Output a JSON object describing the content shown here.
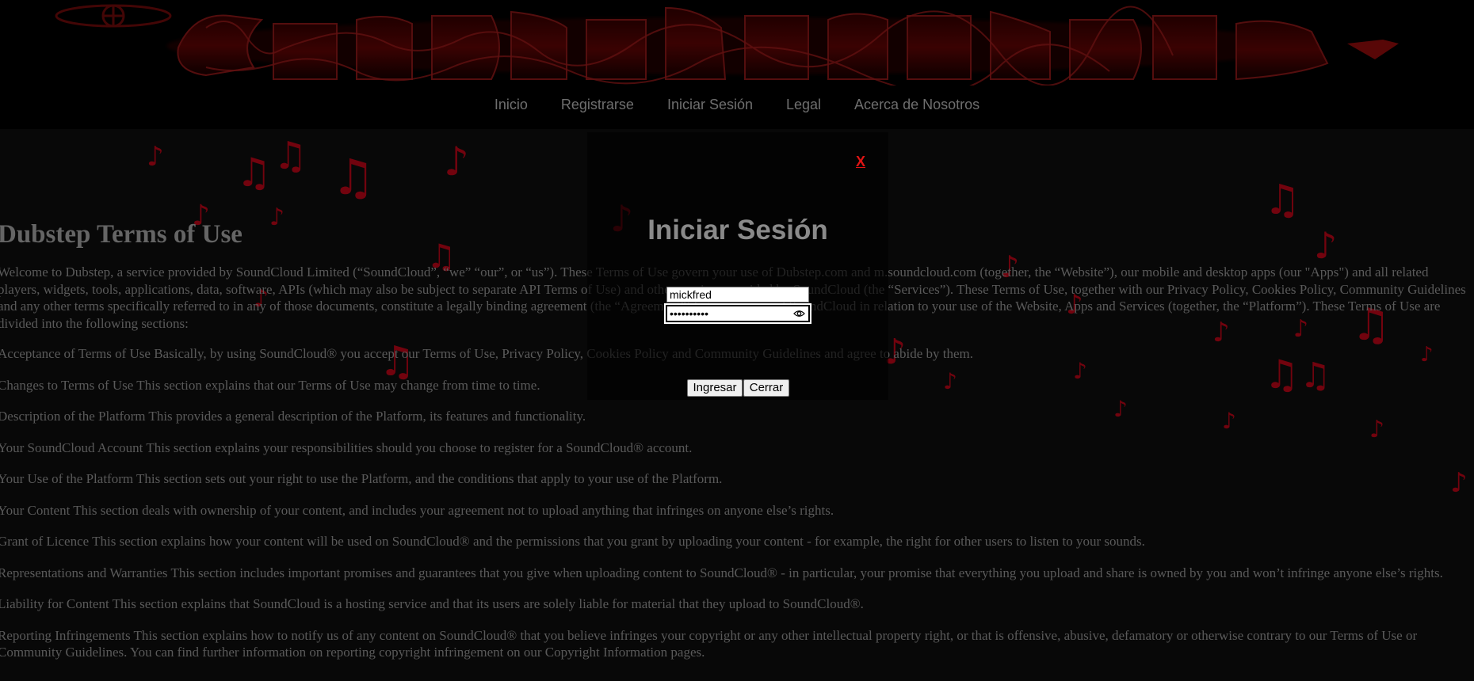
{
  "nav": {
    "items": [
      {
        "label": "Inicio"
      },
      {
        "label": "Registrarse"
      },
      {
        "label": "Iniciar Sesión"
      },
      {
        "label": "Legal"
      },
      {
        "label": "Acerca de Nosotros"
      }
    ]
  },
  "terms": {
    "title": "Dubstep Terms of Use",
    "intro": "Welcome to Dubstep, a service provided by SoundCloud Limited (“SoundCloud”, “we” “our”, or “us”). These Terms of Use govern your use of Dubstep.com and m.soundcloud.com (together, the “Website”), our mobile and desktop apps (our \"Apps\") and all related players, widgets, tools, applications, data, software, APIs (which may also be subject to separate API Terms of Use) and other services provided by SoundCloud (the “Services”). These Terms of Use, together with our Privacy Policy, Cookies Policy, Community Guidelines and any other terms specifically referred to in any of those documents, constitute a legally binding agreement (the “Agreement”) between you and SoundCloud in relation to your use of the Website, Apps and Services (together, the “Platform”). These Terms of Use are divided into the following sections:",
    "sections": [
      "Acceptance of Terms of Use Basically, by using SoundCloud® you accept our Terms of Use, Privacy Policy, Cookies Policy and Community Guidelines and agree to abide by them.",
      "Changes to Terms of Use This section explains that our Terms of Use may change from time to time.",
      "Description of the Platform This provides a general description of the Platform, its features and functionality.",
      "Your SoundCloud Account This section explains your responsibilities should you choose to register for a SoundCloud® account.",
      "Your Use of the Platform This section sets out your right to use the Platform, and the conditions that apply to your use of the Platform.",
      "Your Content This section deals with ownership of your content, and includes your agreement not to upload anything that infringes on anyone else’s rights.",
      "Grant of Licence This section explains how your content will be used on SoundCloud® and the permissions that you grant by uploading your content - for example, the right for other users to listen to your sounds.",
      "Representations and Warranties This section includes important promises and guarantees that you give when uploading content to SoundCloud® - in particular, your promise that everything you upload and share is owned by you and won’t infringe anyone else’s rights.",
      "Liability for Content This section explains that SoundCloud is a hosting service and that its users are solely liable for material that they upload to SoundCloud®.",
      "Reporting Infringements This section explains how to notify us of any content on SoundCloud® that you believe infringes your copyright or any other intellectual property right, or that is offensive, abusive, defamatory or otherwise contrary to our Terms of Use or Community Guidelines. You can find further information on reporting copyright infringement on our Copyright Information pages."
    ]
  },
  "modal": {
    "close_label": "X",
    "title": "Iniciar Sesión",
    "username_value": "mickfred",
    "password_value": "••••••••••",
    "submit_label": "Ingresar",
    "cancel_label": "Cerrar"
  },
  "colors": {
    "accent_red": "#e01414",
    "note_red": "#d0061a",
    "background": "#0f0f0f"
  },
  "icons": [
    "logo-banner",
    "music-note-icon",
    "eye-icon"
  ]
}
